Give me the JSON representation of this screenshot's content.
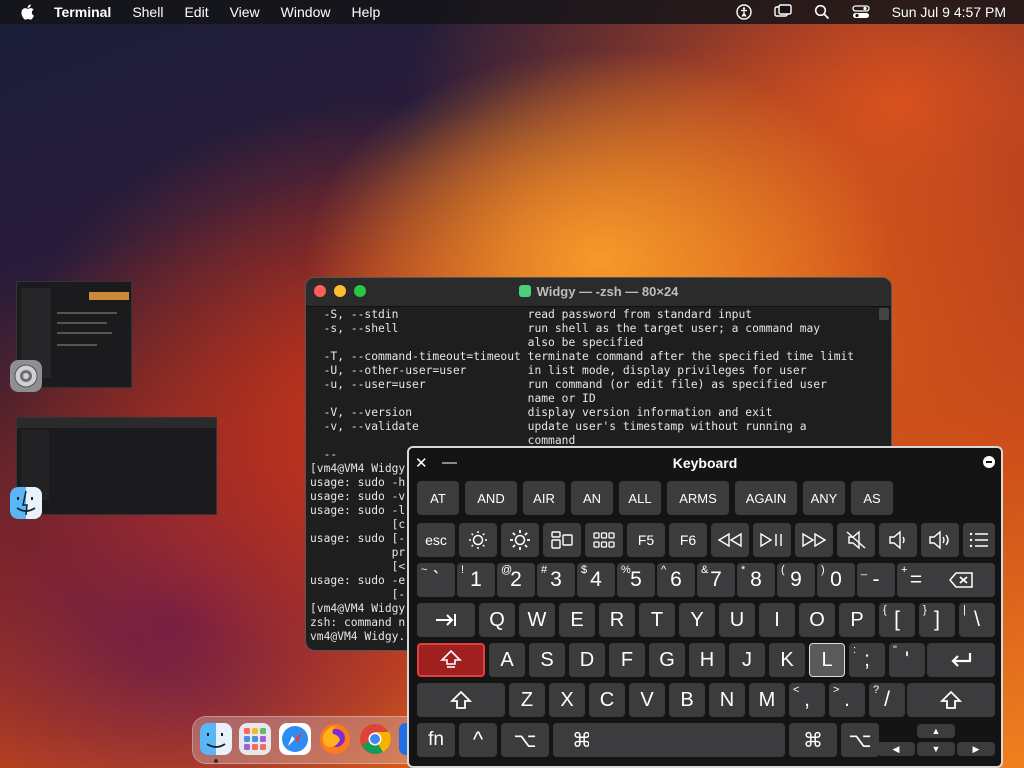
{
  "menubar": {
    "app_name": "Terminal",
    "items": [
      "Shell",
      "Edit",
      "View",
      "Window",
      "Help"
    ],
    "datetime": "Sun Jul 9  4:57 PM"
  },
  "terminal": {
    "title": "Widgy — -zsh — 80×24",
    "lines": [
      "  -S, --stdin                   read password from standard input",
      "  -s, --shell                   run shell as the target user; a command may",
      "                                also be specified",
      "  -T, --command-timeout=timeout terminate command after the specified time limit",
      "  -U, --other-user=user         in list mode, display privileges for user",
      "  -u, --user=user               run command (or edit file) as specified user",
      "                                name or ID",
      "  -V, --version                 display version information and exit",
      "  -v, --validate                update user's timestamp without running a",
      "                                command",
      "  --",
      "[vm4@VM4 Widgy.",
      "usage: sudo -h",
      "usage: sudo -v",
      "usage: sudo -l",
      "            [c",
      "usage: sudo [-",
      "            pr",
      "            [<",
      "usage: sudo -e",
      "            [-",
      "[vm4@VM4 Widgy.",
      "zsh: command n",
      "vm4@VM4 Widgy."
    ]
  },
  "keyboard": {
    "title": "Keyboard",
    "close": "✕",
    "minimize": "—",
    "suggestions": [
      "AT",
      "AND",
      "AIR",
      "AN",
      "ALL",
      "ARMS",
      "AGAIN",
      "ANY",
      "AS"
    ],
    "esc": "esc",
    "f5": "F5",
    "f6": "F6",
    "number_row": [
      {
        "shift": "~",
        "main": "`"
      },
      {
        "shift": "!",
        "main": "1"
      },
      {
        "shift": "@",
        "main": "2"
      },
      {
        "shift": "#",
        "main": "3"
      },
      {
        "shift": "$",
        "main": "4"
      },
      {
        "shift": "%",
        "main": "5"
      },
      {
        "shift": "^",
        "main": "6"
      },
      {
        "shift": "&",
        "main": "7"
      },
      {
        "shift": "*",
        "main": "8"
      },
      {
        "shift": "(",
        "main": "9"
      },
      {
        "shift": ")",
        "main": "0"
      },
      {
        "shift": "_",
        "main": "-"
      },
      {
        "shift": "+",
        "main": "="
      }
    ],
    "row_q": [
      "Q",
      "W",
      "E",
      "R",
      "T",
      "Y",
      "U",
      "I",
      "O",
      "P"
    ],
    "row_q_sym": [
      {
        "shift": "{",
        "main": "["
      },
      {
        "shift": "}",
        "main": "]"
      },
      {
        "shift": "|",
        "main": "\\"
      }
    ],
    "row_a": [
      "A",
      "S",
      "D",
      "F",
      "G",
      "H",
      "J",
      "K",
      "L"
    ],
    "row_a_sym": [
      {
        "shift": ":",
        "main": ";"
      },
      {
        "shift": "\"",
        "main": "'"
      }
    ],
    "row_z": [
      "Z",
      "X",
      "C",
      "V",
      "B",
      "N",
      "M"
    ],
    "row_z_sym": [
      {
        "shift": "<",
        "main": ","
      },
      {
        "shift": ">",
        "main": "."
      },
      {
        "shift": "?",
        "main": "/"
      }
    ],
    "fn": "fn",
    "ctrl": "^",
    "option": "⌥",
    "command": "⌘",
    "tab": "⇥",
    "return": "⏎",
    "shift": "⇧",
    "delete": "⌫"
  }
}
